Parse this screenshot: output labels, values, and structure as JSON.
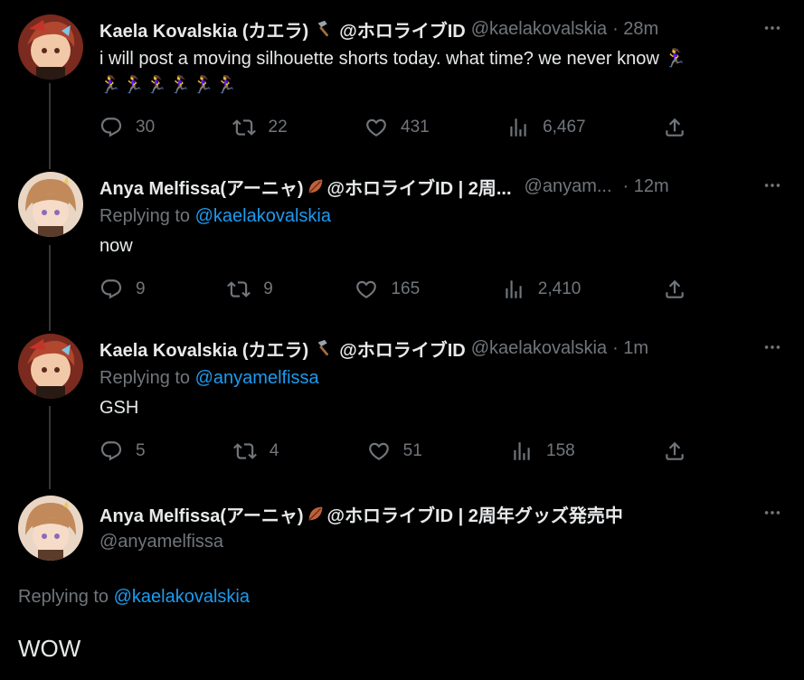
{
  "tweets": [
    {
      "name": "Kaela Kovalskia (カエラ)",
      "name_suffix": "@ホロライブID",
      "handle": "@kaelakovalskia",
      "time": "· 28m",
      "text_line1": "i will post a moving silhouette shorts today. what time? we never know 🏃‍♀️",
      "text_line2": "🏃‍♀️🏃‍♀️🏃‍♀️🏃‍♀️🏃‍♀️🏃‍♀️",
      "replies": "30",
      "reposts": "22",
      "likes": "431",
      "views": "6,467"
    },
    {
      "name": "Anya Melfissa(アーニャ)",
      "name_suffix": "@ホロライブID | 2周...",
      "handle": "@anyam...",
      "time": "· 12m",
      "replying_label": "Replying to",
      "replying_to": "@kaelakovalskia",
      "text": "now",
      "replies": "9",
      "reposts": "9",
      "likes": "165",
      "views": "2,410"
    },
    {
      "name": "Kaela Kovalskia (カエラ)",
      "name_suffix": "@ホロライブID",
      "handle": "@kaelakovalskia",
      "time": "· 1m",
      "replying_label": "Replying to",
      "replying_to": "@anyamelfissa",
      "text": "GSH",
      "replies": "5",
      "reposts": "4",
      "likes": "51",
      "views": "158"
    }
  ],
  "main_tweet": {
    "name": "Anya Melfissa(アーニャ)",
    "name_suffix": "@ホロライブID | 2周年グッズ発売中",
    "handle": "@anyamelfissa",
    "replying_label": "Replying to",
    "replying_to": "@kaelakovalskia",
    "text": "WOW"
  },
  "icons": {
    "reply": "reply-icon",
    "repost": "repost-icon",
    "like": "heart-icon",
    "views": "views-icon",
    "share": "share-icon",
    "more": "more-icon",
    "hammer": "hammer-emoji",
    "leaf": "leaf-emoji"
  },
  "colors": {
    "background": "#000000",
    "text": "#e7e9ea",
    "muted": "#71767b",
    "accent": "#1d9bf0",
    "thread_line": "#333639"
  }
}
